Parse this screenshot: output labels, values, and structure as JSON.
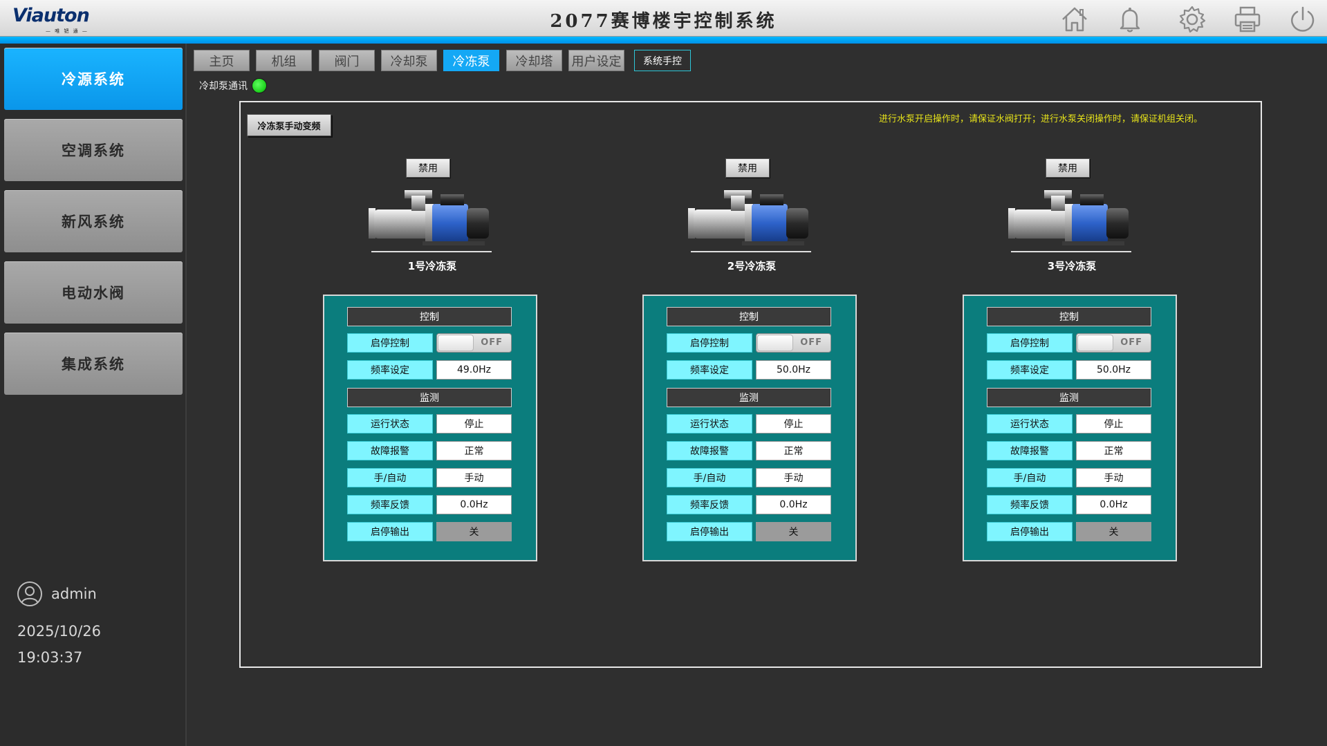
{
  "header": {
    "logo": "Viauton",
    "logo_sub": "— 唯 钯 通 —",
    "title": "2077赛博楼宇控制系统",
    "icons": [
      "home-icon",
      "bell-icon",
      "gear-icon",
      "printer-icon",
      "power-icon"
    ]
  },
  "sidebar": {
    "items": [
      {
        "label": "冷源系统",
        "active": true
      },
      {
        "label": "空调系统",
        "active": false
      },
      {
        "label": "新风系统",
        "active": false
      },
      {
        "label": "电动水阀",
        "active": false
      },
      {
        "label": "集成系统",
        "active": false
      }
    ],
    "user": "admin",
    "date": "2025/10/26",
    "time": "19:03:37"
  },
  "tabs": [
    {
      "label": "主页"
    },
    {
      "label": "机组"
    },
    {
      "label": "阀门"
    },
    {
      "label": "冷却泵"
    },
    {
      "label": "冷冻泵",
      "active": true
    },
    {
      "label": "冷却塔"
    },
    {
      "label": "用户设定"
    },
    {
      "label": "系统手控"
    }
  ],
  "comm_label": "冷却泵通讯",
  "comm_status_color": "#1fd11f",
  "manual_freq_button": "冷冻泵手动变频",
  "notice": "进行水泵开启操作时，请保证水阀打开；进行水泵关闭操作时，请保证机组关闭。",
  "colors": {
    "accent": "#14a8f5",
    "panel_bg": "#0b7d7d",
    "label_bg": "#7ff5ff",
    "notice": "#e8e41a"
  },
  "pumps": [
    {
      "name": "1号冷冻泵",
      "disable_label": "禁用",
      "control_title": "控制",
      "monitor_title": "监测",
      "rows": {
        "start_stop_label": "启停控制",
        "start_stop_value": "OFF",
        "freq_set_label": "频率设定",
        "freq_set_value": "49.0Hz",
        "run_state_label": "运行状态",
        "run_state_value": "停止",
        "fault_label": "故障报警",
        "fault_value": "正常",
        "mode_label": "手/自动",
        "mode_value": "手动",
        "freq_fb_label": "频率反馈",
        "freq_fb_value": "0.0Hz",
        "output_label": "启停输出",
        "output_value": "关"
      }
    },
    {
      "name": "2号冷冻泵",
      "disable_label": "禁用",
      "control_title": "控制",
      "monitor_title": "监测",
      "rows": {
        "start_stop_label": "启停控制",
        "start_stop_value": "OFF",
        "freq_set_label": "频率设定",
        "freq_set_value": "50.0Hz",
        "run_state_label": "运行状态",
        "run_state_value": "停止",
        "fault_label": "故障报警",
        "fault_value": "正常",
        "mode_label": "手/自动",
        "mode_value": "手动",
        "freq_fb_label": "频率反馈",
        "freq_fb_value": "0.0Hz",
        "output_label": "启停输出",
        "output_value": "关"
      }
    },
    {
      "name": "3号冷冻泵",
      "disable_label": "禁用",
      "control_title": "控制",
      "monitor_title": "监测",
      "rows": {
        "start_stop_label": "启停控制",
        "start_stop_value": "OFF",
        "freq_set_label": "频率设定",
        "freq_set_value": "50.0Hz",
        "run_state_label": "运行状态",
        "run_state_value": "停止",
        "fault_label": "故障报警",
        "fault_value": "正常",
        "mode_label": "手/自动",
        "mode_value": "手动",
        "freq_fb_label": "频率反馈",
        "freq_fb_value": "0.0Hz",
        "output_label": "启停输出",
        "output_value": "关"
      }
    }
  ]
}
